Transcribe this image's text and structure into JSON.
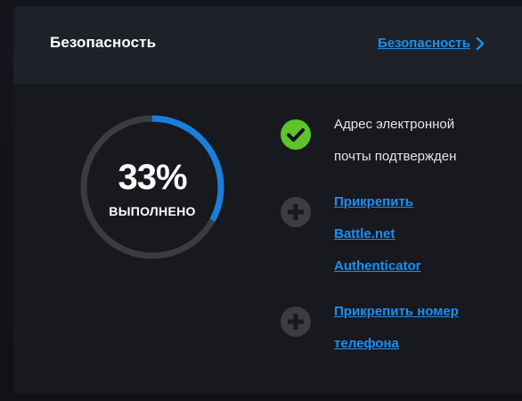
{
  "panel": {
    "title": "Безопасность",
    "header_link": "Безопасность"
  },
  "progress": {
    "percent": 33,
    "value_text": "33%",
    "caption": "ВЫПОЛНЕНО"
  },
  "items": {
    "email": {
      "status": "done",
      "line1": "Адрес электронной",
      "line2": "почты подтвержден"
    },
    "authenticator": {
      "status": "add",
      "line1": "Прикрепить",
      "line2": "Battle.net",
      "line3": "Authenticator"
    },
    "phone": {
      "status": "add",
      "line1": "Прикрепить номер",
      "line2": "телефона"
    }
  },
  "colors": {
    "accent": "#1c8ff0",
    "success": "#5fc32b",
    "ring_track": "#3a3c42",
    "ring_fill": "#1a7fdc"
  },
  "icons": {
    "header_link": "chevron-right-icon",
    "email": "check-circle-icon",
    "authenticator": "plus-circle-icon",
    "phone": "plus-circle-icon"
  }
}
